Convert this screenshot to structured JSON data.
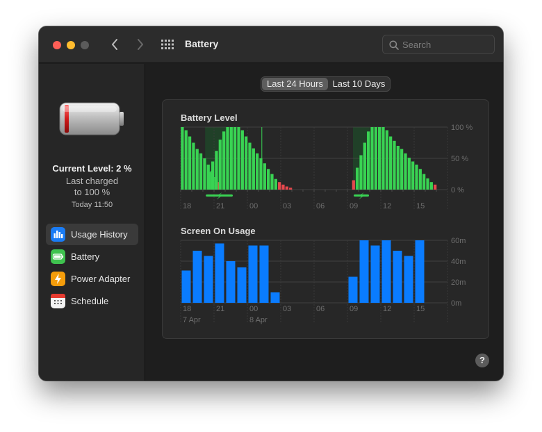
{
  "window": {
    "title": "Battery",
    "search": {
      "placeholder": "Search",
      "value": ""
    }
  },
  "sidebar": {
    "current_level": "Current Level: 2 %",
    "last_charged": "Last charged",
    "charged_to": "to 100 %",
    "charged_time": "Today 11:50",
    "items": [
      {
        "label": "Usage History",
        "icon": "bar-chart-icon",
        "color": "#1a7cf5",
        "selected": true
      },
      {
        "label": "Battery",
        "icon": "battery-icon",
        "color": "#3fc24f",
        "selected": false
      },
      {
        "label": "Power Adapter",
        "icon": "power-adapter-icon",
        "color": "#f59d0b",
        "selected": false
      },
      {
        "label": "Schedule",
        "icon": "calendar-icon",
        "color": "#f2f2f2",
        "selected": false
      }
    ]
  },
  "segmented_control": {
    "options": [
      "Last 24 Hours",
      "Last 10 Days"
    ],
    "selected": "Last 24 Hours"
  },
  "colors": {
    "battery_green": "#39d353",
    "battery_low": "#e5484d",
    "charging_shade": "#1f4a29",
    "screen_blue": "#0a7cff",
    "grid": "#4a4a4a"
  },
  "chart_data": [
    {
      "type": "bar",
      "title": "Battery Level",
      "ylim": [
        0,
        100
      ],
      "y_ticks": [
        "100 %",
        "50 %",
        "0 %"
      ],
      "x_ticks": [
        "18",
        "21",
        "00",
        "03",
        "06",
        "09",
        "12",
        "15"
      ],
      "charging_hours": [
        [
          2.2,
          4.75
        ],
        [
          15.5,
          17.0
        ]
      ],
      "segments": [
        {
          "start_hour": 0.0,
          "values": [
            100,
            95,
            85,
            75,
            65,
            58,
            50,
            40,
            30,
            20,
            12
          ],
          "low_from_index": 10
        },
        {
          "start_hour": 2.4,
          "values": [
            28,
            45,
            62,
            80,
            93,
            100,
            100,
            100,
            100,
            95,
            85,
            75,
            66,
            58,
            50,
            42,
            33,
            25,
            17,
            12,
            8,
            5,
            3
          ],
          "low_from_index": 19
        },
        {
          "start_hour": 15.4,
          "values": [
            15,
            35,
            55,
            75,
            93,
            100,
            100,
            100,
            100,
            95,
            85,
            78,
            70,
            65,
            58,
            51,
            45,
            40,
            33,
            25,
            18,
            12,
            8
          ],
          "low_from_index": 0,
          "low_count": 1,
          "low_last": true
        }
      ],
      "charging_labels": [
        "⚡",
        "⚡"
      ]
    },
    {
      "type": "bar",
      "title": "Screen On Usage",
      "ylim": [
        0,
        60
      ],
      "y_ticks": [
        "60m",
        "40m",
        "20m",
        "0m"
      ],
      "x_ticks": [
        "18",
        "21",
        "00",
        "03",
        "06",
        "09",
        "12",
        "15"
      ],
      "date_labels": [
        "7 Apr",
        "8 Apr"
      ],
      "hours": [
        0,
        1,
        2,
        3,
        4,
        5,
        6,
        7,
        8,
        15,
        16,
        17,
        18,
        19,
        20,
        21
      ],
      "values": [
        31,
        50,
        45,
        57,
        40,
        34,
        55,
        55,
        10,
        25,
        60,
        55,
        60,
        50,
        45,
        60
      ]
    }
  ],
  "help_label": "?"
}
